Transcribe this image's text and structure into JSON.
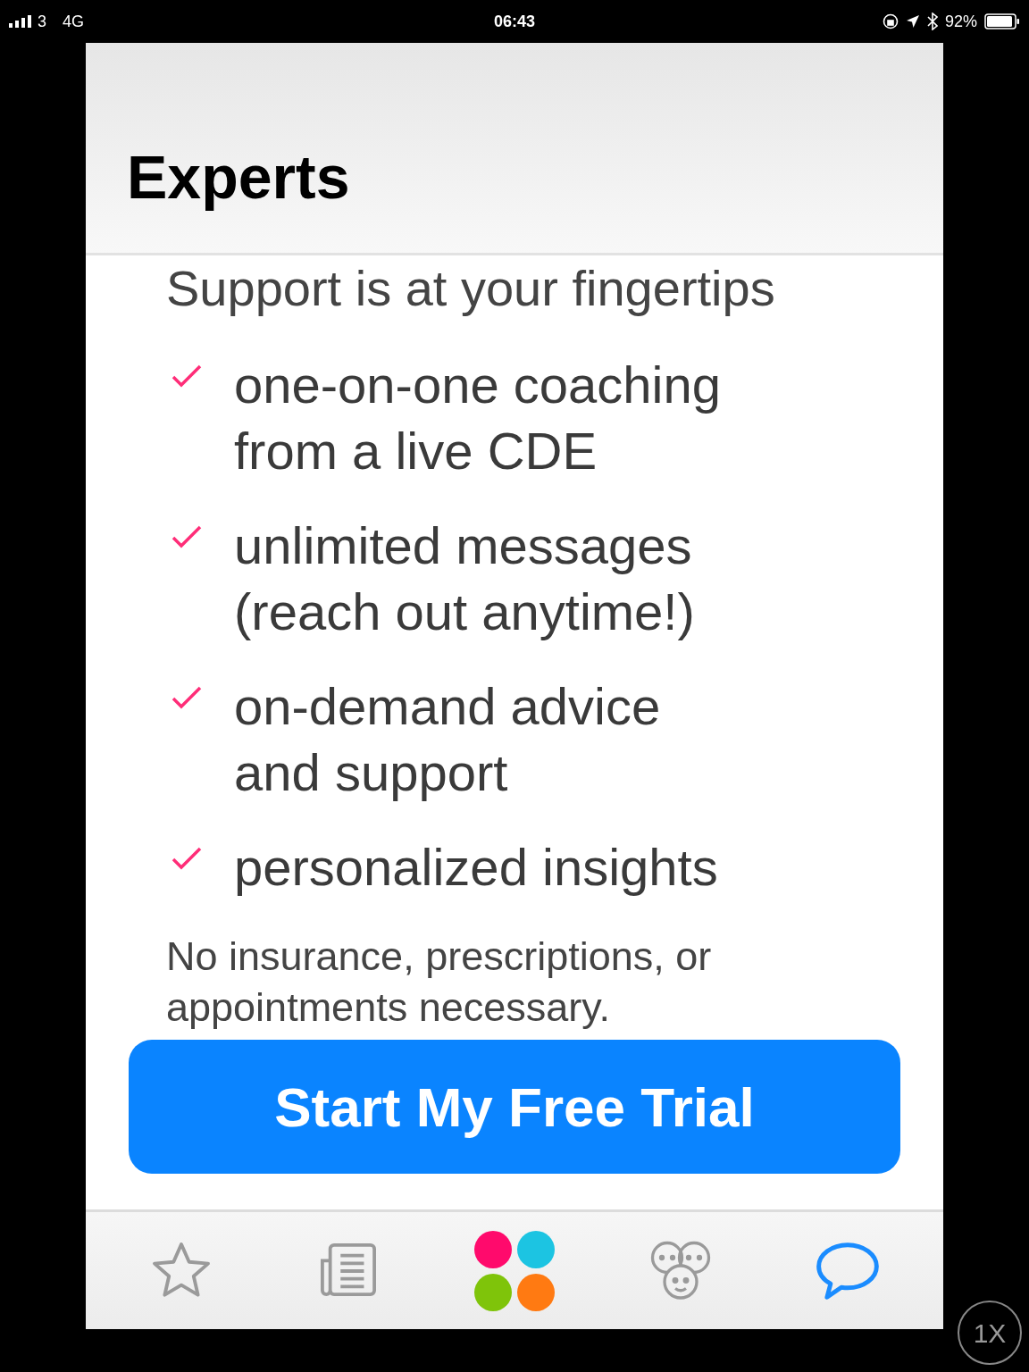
{
  "status_bar": {
    "carrier": "3",
    "network": "4G",
    "time": "06:43",
    "battery": "92%"
  },
  "header": {
    "title": "Experts"
  },
  "subtitle": "Support is at your fingertips",
  "features": [
    {
      "text": "one-on-one coaching from a live CDE"
    },
    {
      "text": "unlimited messages (reach out anytime!)"
    },
    {
      "text": "on-demand advice and support"
    },
    {
      "text": "personalized insights"
    }
  ],
  "note": "No insurance, prescriptions, or appointments necessary.",
  "cta": "Start My Free Trial",
  "tabs": [
    {
      "kind": "star",
      "selected": false
    },
    {
      "kind": "news",
      "selected": false
    },
    {
      "kind": "logo",
      "selected": false
    },
    {
      "kind": "people",
      "selected": false
    },
    {
      "kind": "chat",
      "selected": true
    }
  ],
  "zoom_badge": "1X"
}
